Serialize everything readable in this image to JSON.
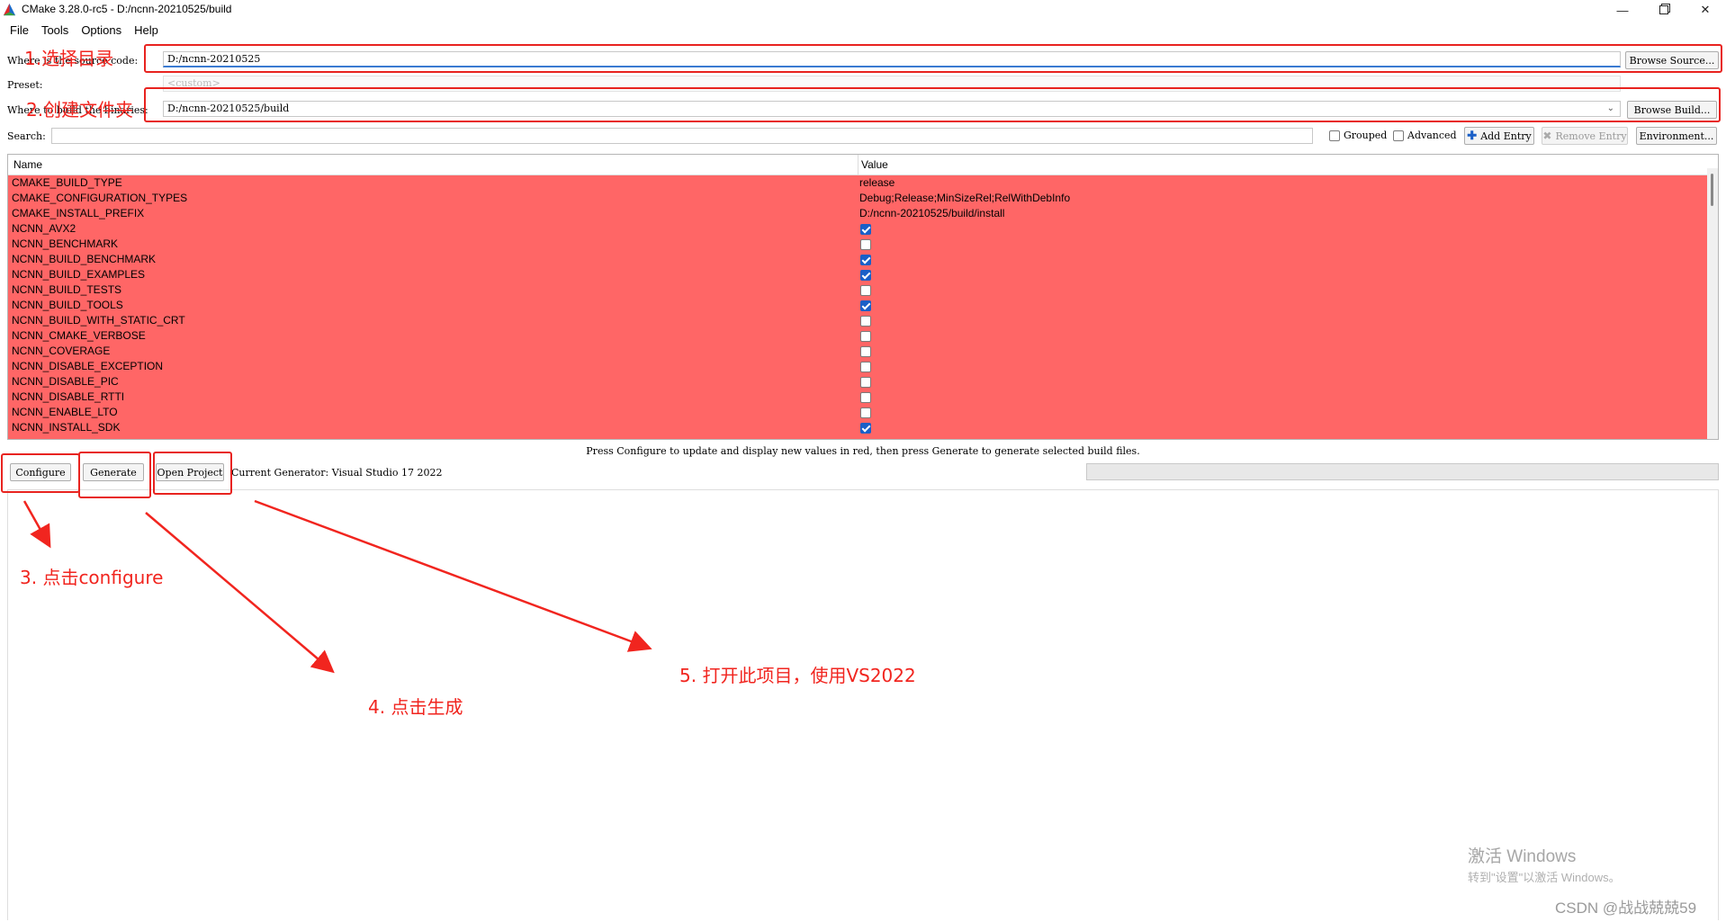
{
  "window": {
    "title": "CMake 3.28.0-rc5 - D:/ncnn-20210525/build"
  },
  "menu": [
    "File",
    "Tools",
    "Options",
    "Help"
  ],
  "source": {
    "label": "Where is the source code:",
    "value": "D:/ncnn-20210525",
    "browse": "Browse Source..."
  },
  "preset": {
    "label": "Preset:",
    "value": "<custom>"
  },
  "build": {
    "label": "Where to build the binaries:",
    "value": "D:/ncnn-20210525/build",
    "browse": "Browse Build..."
  },
  "search": {
    "label": "Search:",
    "value": ""
  },
  "options": {
    "grouped": "Grouped",
    "advanced": "Advanced",
    "add_entry": "Add Entry",
    "remove_entry": "Remove Entry",
    "environment": "Environment..."
  },
  "table": {
    "headers": [
      "Name",
      "Value"
    ],
    "rows": [
      {
        "name": "CMAKE_BUILD_TYPE",
        "value": "release"
      },
      {
        "name": "CMAKE_CONFIGURATION_TYPES",
        "value": "Debug;Release;MinSizeRel;RelWithDebInfo"
      },
      {
        "name": "CMAKE_INSTALL_PREFIX",
        "value": "D:/ncnn-20210525/build/install"
      },
      {
        "name": "NCNN_AVX2",
        "checked": true
      },
      {
        "name": "NCNN_BENCHMARK",
        "checked": false
      },
      {
        "name": "NCNN_BUILD_BENCHMARK",
        "checked": true
      },
      {
        "name": "NCNN_BUILD_EXAMPLES",
        "checked": true
      },
      {
        "name": "NCNN_BUILD_TESTS",
        "checked": false
      },
      {
        "name": "NCNN_BUILD_TOOLS",
        "checked": true
      },
      {
        "name": "NCNN_BUILD_WITH_STATIC_CRT",
        "checked": false
      },
      {
        "name": "NCNN_CMAKE_VERBOSE",
        "checked": false
      },
      {
        "name": "NCNN_COVERAGE",
        "checked": false
      },
      {
        "name": "NCNN_DISABLE_EXCEPTION",
        "checked": false
      },
      {
        "name": "NCNN_DISABLE_PIC",
        "checked": false
      },
      {
        "name": "NCNN_DISABLE_RTTI",
        "checked": false
      },
      {
        "name": "NCNN_ENABLE_LTO",
        "checked": false
      },
      {
        "name": "NCNN_INSTALL_SDK",
        "checked": true
      }
    ]
  },
  "hint": "Press Configure to update and display new values in red,  then press Generate to generate selected build files.",
  "actions": {
    "configure": "Configure",
    "generate": "Generate",
    "open_project": "Open Project",
    "generator": "Current Generator: Visual Studio 17 2022"
  },
  "annotations": {
    "a1": "1.选择目录",
    "a2": "2.创建文件夹",
    "a3": "3. 点击configure",
    "a4": "4. 点击生成",
    "a5": "5. 打开此项目，使用VS2022"
  },
  "watermark": {
    "line1": "激活 Windows",
    "line2": "转到\"设置\"以激活 Windows。",
    "csdn": "CSDN @战战兢兢59"
  },
  "colors": {
    "changed_row": "#ff6666",
    "annotation": "#f1251f",
    "checkbox_on": "#1a5fc7"
  }
}
